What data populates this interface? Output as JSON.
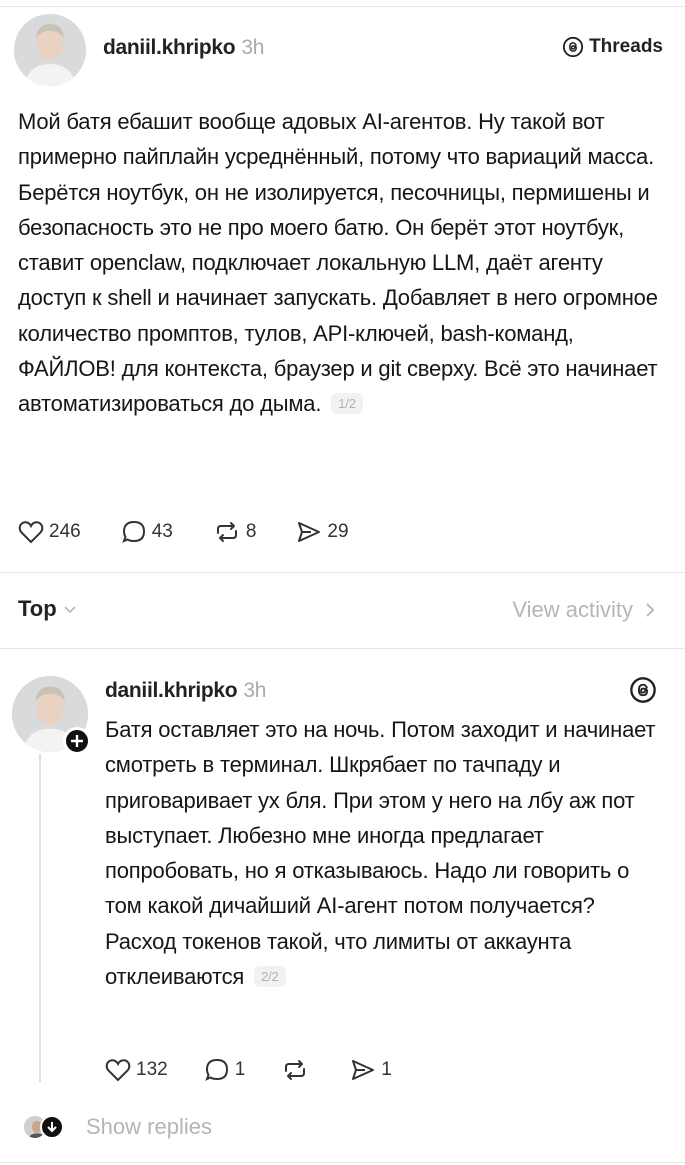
{
  "post1": {
    "username": "daniil.khripko",
    "time": "3h",
    "threads_label": "Threads",
    "text": "Мой батя ебашит вообще адовых AI-агентов. Ну такой вот примерно пайплайн усреднённый, потому что вариаций масса. Берётся ноутбук, он не изолируется, песочницы, пермишены и безопасность это не про моего батю. Он берёт этот ноутбук, ставит openclaw, подключает локальную LLM, даёт агенту доступ к shell и начинает запускать. Добавляет в него огромное количество промптов, тулов, API-ключей, bash-команд, ФАЙЛОВ! для контекста, браузер и git сверху. Всё это начинает автоматизироваться до дыма.",
    "pager": "1/2",
    "likes": "246",
    "comments": "43",
    "reposts": "8",
    "shares": "29"
  },
  "sort": {
    "label": "Top",
    "view_activity": "View activity"
  },
  "post2": {
    "username": "daniil.khripko",
    "time": "3h",
    "text": "Батя оставляет это на ночь. Потом заходит и начинает смотреть в терминал. Шкрябает по тачпаду и приговаривает ух бля. При этом у него на лбу аж пот выступает. Любезно мне иногда предлагает попробовать, но я отказываюсь. Надо ли говорить о том какой дичайший AI-агент потом получается? Расход токенов такой, что лимиты от аккаунта отклеиваются",
    "pager": "2/2",
    "likes": "132",
    "comments": "1",
    "reposts": "",
    "shares": "1"
  },
  "show_replies": "Show replies",
  "icons": {
    "like": "heart-icon",
    "comment": "comment-bubble-icon",
    "repost": "repost-icon",
    "share": "send-icon",
    "threads": "threads-logo-icon"
  }
}
